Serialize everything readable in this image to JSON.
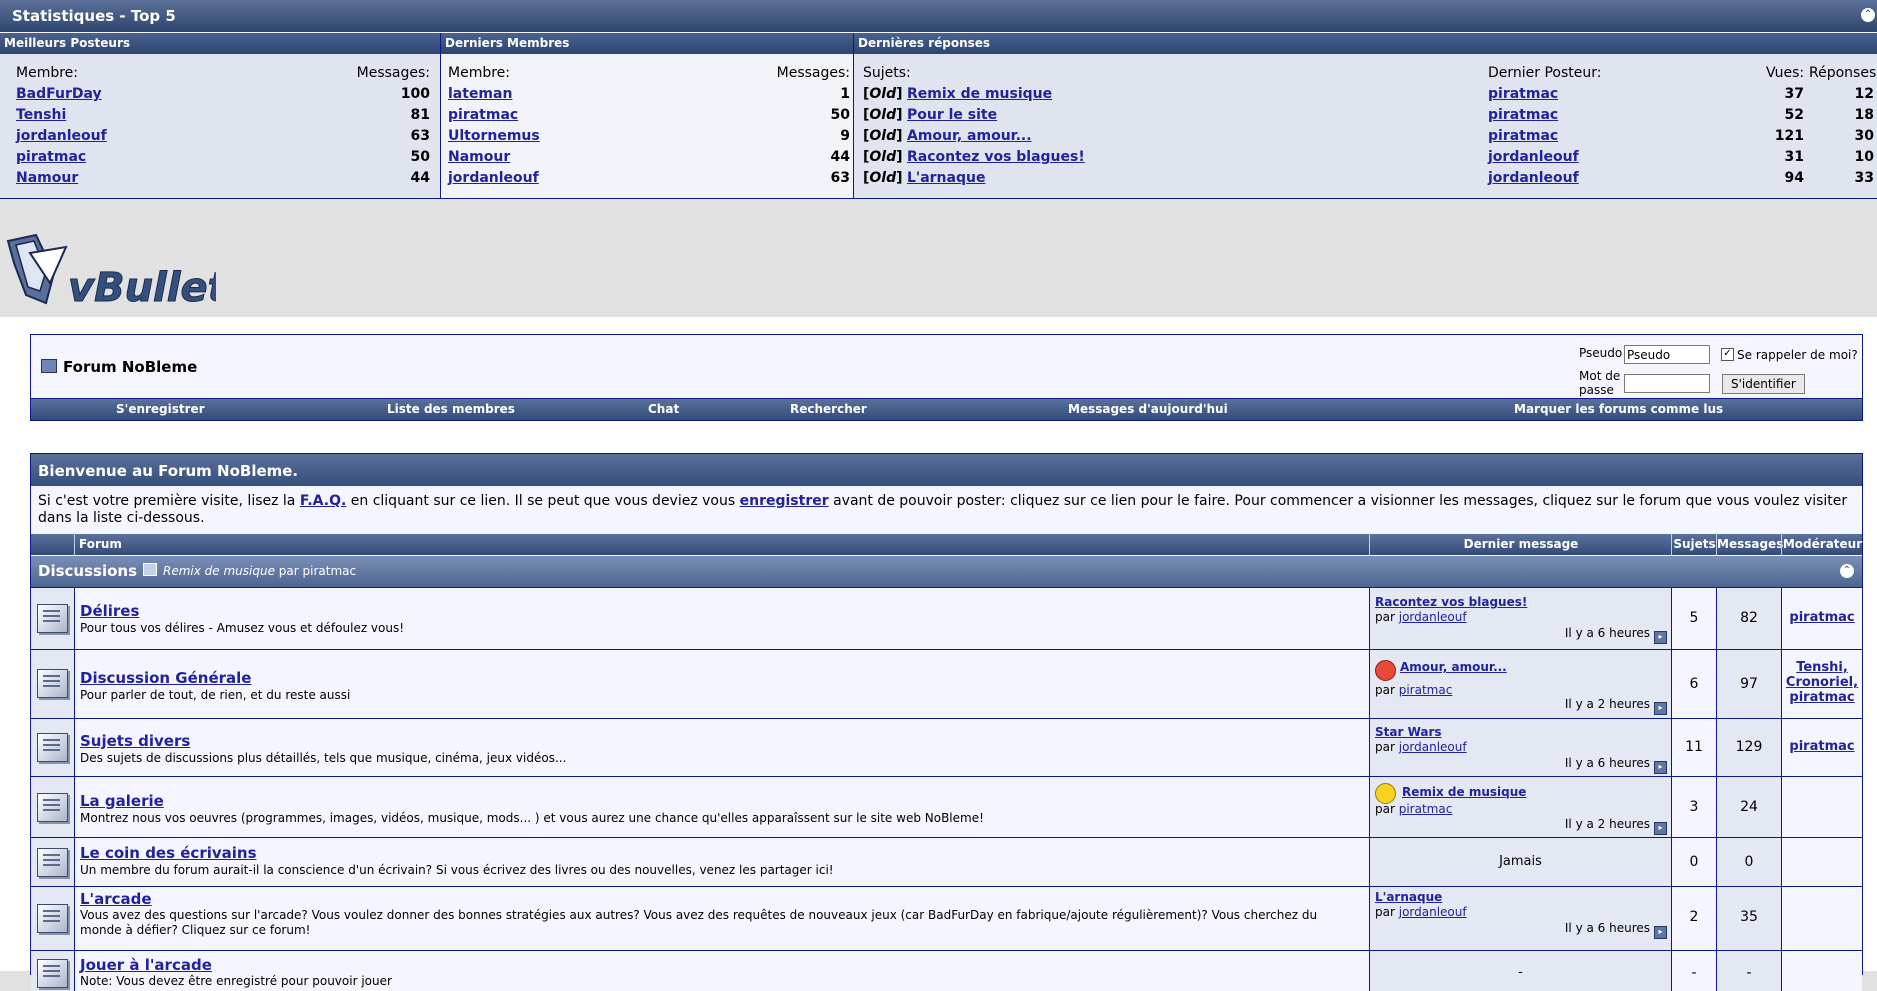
{
  "stats": {
    "title": "Statistiques - Top 5",
    "top_posters": {
      "title": "Meilleurs Posteurs",
      "col_member": "Membre:",
      "col_messages": "Messages:",
      "rows": [
        {
          "name": "BadFurDay",
          "count": "100"
        },
        {
          "name": "Tenshi",
          "count": "81"
        },
        {
          "name": "jordanleouf",
          "count": "63"
        },
        {
          "name": "piratmac",
          "count": "50"
        },
        {
          "name": "Namour",
          "count": "44"
        }
      ]
    },
    "latest_members": {
      "title": "Derniers Membres",
      "col_member": "Membre:",
      "col_messages": "Messages:",
      "rows": [
        {
          "name": "lateman",
          "count": "1"
        },
        {
          "name": "piratmac",
          "count": "50"
        },
        {
          "name": "Ultornemus",
          "count": "9"
        },
        {
          "name": "Namour",
          "count": "44"
        },
        {
          "name": "jordanleouf",
          "count": "63"
        }
      ]
    },
    "latest_replies": {
      "title": "Dernières réponses",
      "col_subjects": "Sujets:",
      "col_last_poster": "Dernier Posteur:",
      "col_views": "Vues:",
      "col_replies": "Réponses:",
      "prefix_open": "[",
      "prefix": "Old",
      "prefix_close": "]",
      "rows": [
        {
          "subject": "Remix de musique",
          "poster": "piratmac",
          "views": "37",
          "replies": "12"
        },
        {
          "subject": "Pour le site",
          "poster": "piratmac",
          "views": "52",
          "replies": "18"
        },
        {
          "subject": "Amour, amour...",
          "poster": "piratmac",
          "views": "121",
          "replies": "30"
        },
        {
          "subject": "Racontez vos blagues!",
          "poster": "jordanleouf",
          "views": "31",
          "replies": "10"
        },
        {
          "subject": "L'arnaque",
          "poster": "jordanleouf",
          "views": "94",
          "replies": "33"
        }
      ]
    }
  },
  "logo_text": "vBulletin",
  "navbox": {
    "forum_title": "Forum NoBleme",
    "login": {
      "pseudo_label": "Pseudo",
      "pseudo_value": "Pseudo",
      "password_label": "Mot de passe",
      "remember_label": "Se rappeler de moi?",
      "remember_checked": true,
      "submit_label": "S'identifier"
    },
    "links": [
      "S'enregistrer",
      "Liste des membres",
      "Chat",
      "Rechercher",
      "Messages d'aujourd'hui",
      "Marquer les forums comme lus"
    ]
  },
  "welcome": {
    "title": "Bienvenue au Forum NoBleme.",
    "text_1": "Si c'est votre première visite, lisez la ",
    "faq_link": "F.A.Q.",
    "text_2": " en cliquant sur ce lien. Il se peut que vous deviez vous ",
    "register_link": "enregistrer",
    "text_3": " avant de pouvoir poster: cliquez sur ce lien pour le faire. Pour commencer a visionner les messages, cliquez sur le forum que vous voulez visiter dans la liste ci-dessous."
  },
  "columns": {
    "forum": "Forum",
    "last_post": "Dernier message",
    "topics": "Sujets",
    "posts": "Messages",
    "moderator": "Modérateur"
  },
  "category": {
    "title": "Discussions",
    "dash": "-",
    "last_subject": "Remix de musique",
    "last_by": "par piratmac"
  },
  "forums": [
    {
      "name": "Délires",
      "desc": "Pour tous vos délires - Amusez vous et défoulez vous!",
      "last_title": "Racontez vos blagues!",
      "last_by_label": "par",
      "last_by": "jordanleouf",
      "last_time": "Il y a 6 heures",
      "topics": "5",
      "posts": "82",
      "moderators": [
        "piratmac"
      ]
    },
    {
      "name": "Discussion Générale",
      "desc": "Pour parler de tout, de rien, et du reste aussi",
      "last_title": "Amour, amour...",
      "last_by_label": "par",
      "last_by": "piratmac",
      "last_time": "Il y a 2 heures",
      "topics": "6",
      "posts": "97",
      "moderators": [
        "Tenshi,",
        "Cronoriel,",
        "piratmac"
      ]
    },
    {
      "name": "Sujets divers",
      "desc": "Des sujets de discussions plus détaillés, tels que musique, cinéma, jeux vidéos...",
      "last_title": "Star Wars",
      "last_by_label": "par",
      "last_by": "jordanleouf",
      "last_time": "Il y a 6 heures",
      "topics": "11",
      "posts": "129",
      "moderators": [
        "piratmac"
      ]
    },
    {
      "name": "La galerie",
      "desc": "Montrez nous vos oeuvres (programmes, images, vidéos, musique, mods... ) et vous aurez une chance qu'elles apparaîssent sur le site web NoBleme!",
      "last_title": "Remix de musique",
      "last_by_label": "par",
      "last_by": "piratmac",
      "last_time": "Il y a 2 heures",
      "topics": "3",
      "posts": "24",
      "moderators": []
    },
    {
      "name": "Le coin des écrivains",
      "desc": "Un membre du forum aurait-il la conscience d'un écrivain? Si vous écrivez des livres ou des nouvelles, venez les partager ici!",
      "last_none": "Jamais",
      "topics": "0",
      "posts": "0",
      "moderators": []
    },
    {
      "name": "L'arcade",
      "desc": "Vous avez des questions sur l'arcade? Vous voulez donner des bonnes stratégies aux autres? Vous avez des requêtes de nouveaux jeux (car BadFurDay en fabrique/ajoute régulièrement)? Vous cherchez du monde à défier? Cliquez sur ce forum!",
      "last_title": "L'arnaque",
      "last_by_label": "par",
      "last_by": "jordanleouf",
      "last_time": "Il y a 6 heures",
      "topics": "2",
      "posts": "35",
      "moderators": []
    },
    {
      "name": "Jouer à l'arcade",
      "desc": "Note: Vous devez être enregistré pour pouvoir jouer",
      "last_none": "-",
      "topics": "-",
      "posts": "-",
      "moderators": []
    }
  ],
  "colors": {
    "header_blue": "#34507c",
    "border_blue": "#0b198c",
    "link": "#22229c",
    "row_light": "#f5f5ff",
    "row_alt": "#e3e8f2"
  }
}
